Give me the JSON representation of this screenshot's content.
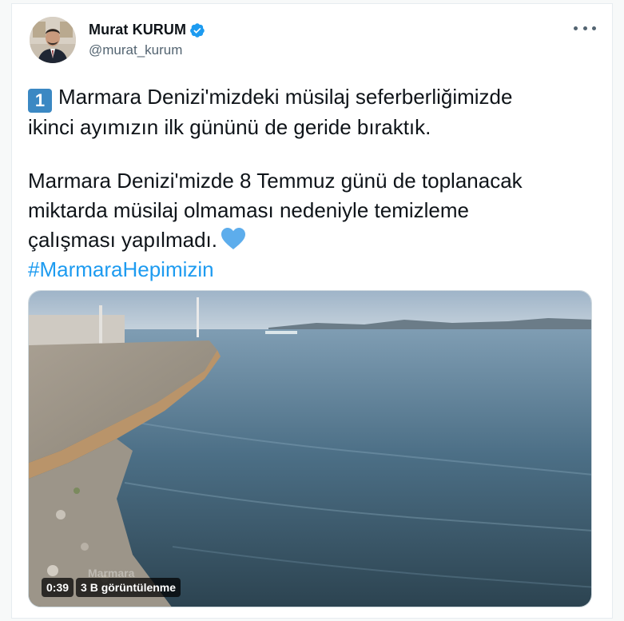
{
  "author": {
    "display_name": "Murat KURUM",
    "handle": "@murat_kurum",
    "verified": true,
    "avatar_icon": "profile-photo"
  },
  "tweet": {
    "keycap": "1",
    "line1": "Marmara Denizi'mizdeki müsilaj seferberliğimizde",
    "line2": "ikinci ayımızın ilk gününü de geride bıraktık.",
    "line3": "Marmara Denizi'mizde 8 Temmuz günü de toplanacak",
    "line4": "miktarda müsilaj olmaması nedeniyle temizleme",
    "line5": "çalışması yapılmadı.",
    "hashtag": "#MarmaraHepimizin"
  },
  "media": {
    "duration": "0:39",
    "views": "3 B görüntülenme",
    "watermark": "Marmara"
  },
  "colors": {
    "link": "#1d9bf0",
    "verified": "#1d9bf0",
    "keycap": "#3b88c3",
    "heart": "#5dadec"
  }
}
